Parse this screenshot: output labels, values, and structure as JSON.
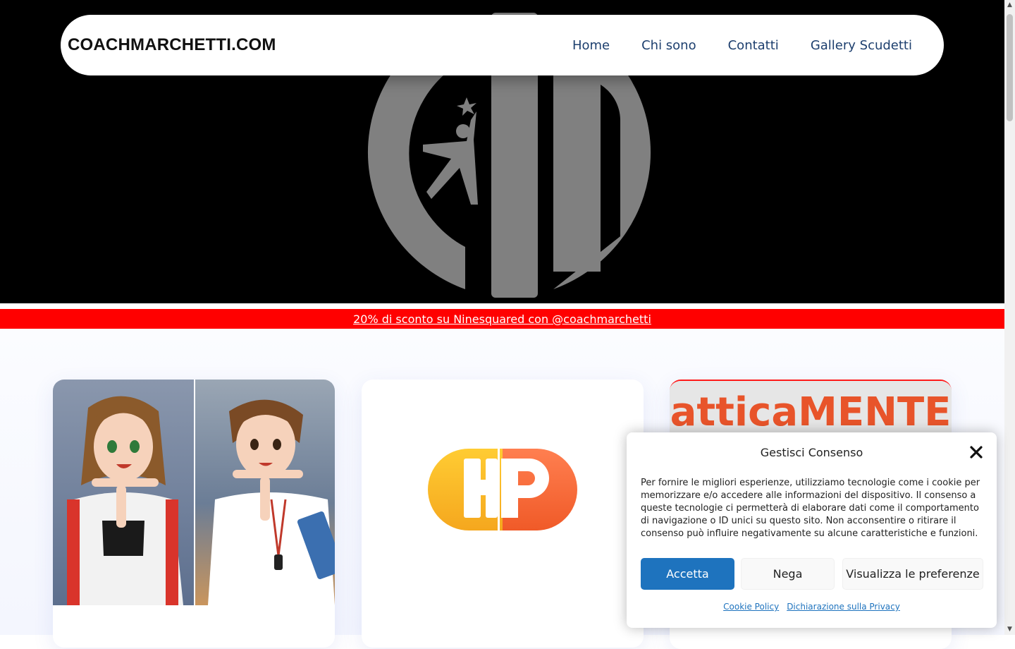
{
  "nav": {
    "brand": "COACHMARCHETTI.COM",
    "items": [
      {
        "label": "Home"
      },
      {
        "label": "Chi sono"
      },
      {
        "label": "Contatti"
      },
      {
        "label": "Gallery Scudetti"
      }
    ]
  },
  "hero": {
    "logo_icon": "cm-volleyball-logo",
    "background_color": "#000000",
    "logo_color": "#808080"
  },
  "promo": {
    "text": "20% di sconto su Ninesquared con @coachmarchetti",
    "background_color": "#ff0000"
  },
  "cards": [
    {
      "image": "anime-referee-time-out-illustration",
      "title": ""
    },
    {
      "image": "hp-logo",
      "logo_text": "HP",
      "title": ""
    },
    {
      "image": "tatticamente-banner",
      "banner_text": "atticaMENTE",
      "title": ""
    }
  ],
  "cookie": {
    "title": "Gestisci Consenso",
    "text": "Per fornire le migliori esperienze, utilizziamo tecnologie come i cookie per memorizzare e/o accedere alle informazioni del dispositivo. Il consenso a queste tecnologie ci permetterà di elaborare dati come il comportamento di navigazione o ID unici su questo sito. Non acconsentire o ritirare il consenso può influire negativamente su alcune caratteristiche e funzioni.",
    "accept_label": "Accetta",
    "deny_label": "Nega",
    "prefs_label": "Visualizza le preferenze",
    "links": [
      {
        "label": "Cookie Policy"
      },
      {
        "label": "Dichiarazione sulla Privacy"
      }
    ],
    "accent_color": "#1e73be"
  }
}
